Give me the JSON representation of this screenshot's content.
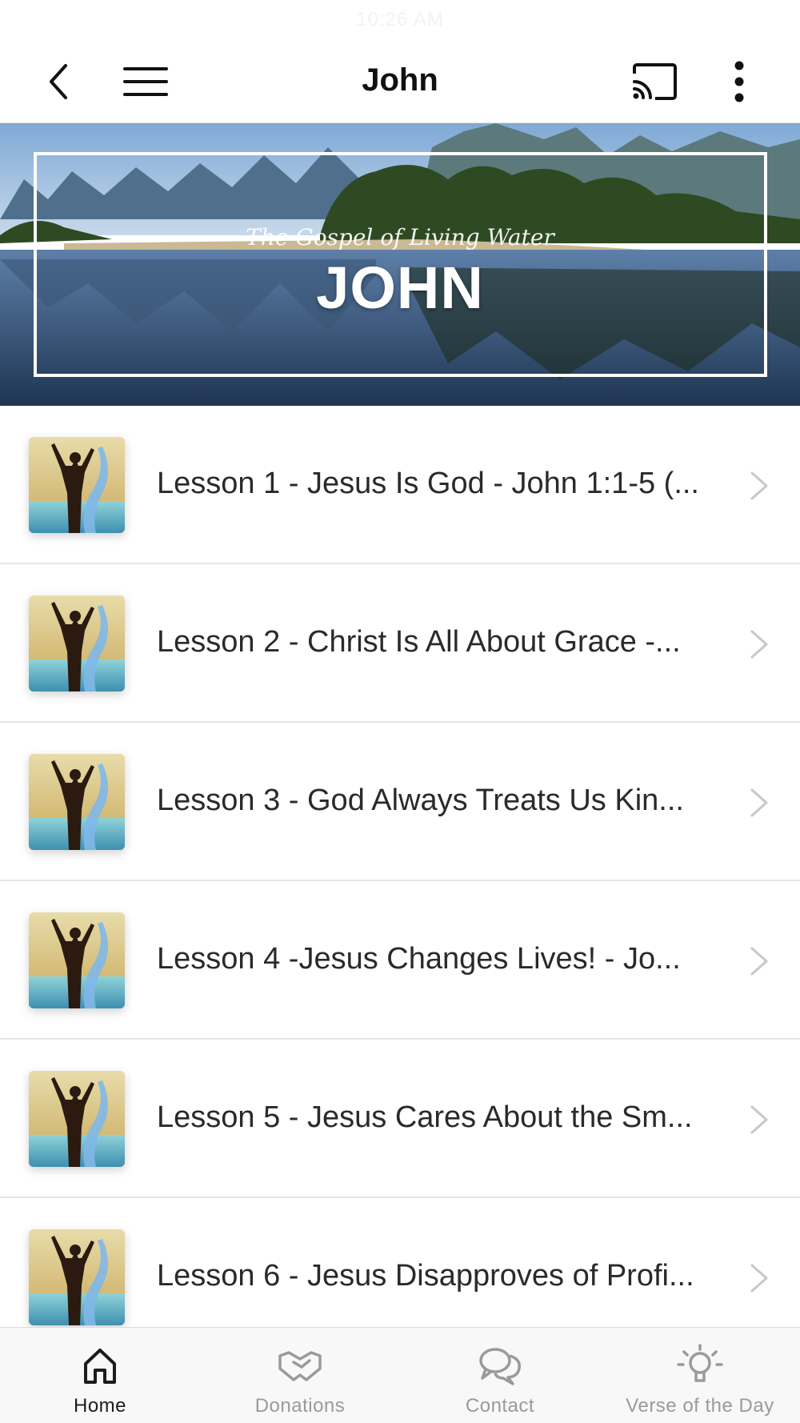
{
  "status_bar": {
    "time": "10:26 AM"
  },
  "app_bar": {
    "title": "John",
    "back_icon": "chevron-left-icon",
    "menu_icon": "hamburger-menu-icon",
    "cast_icon": "cast-icon",
    "more_icon": "more-vertical-icon"
  },
  "hero": {
    "subtitle": "The Gospel of Living Water",
    "title": "JOHN"
  },
  "lessons": [
    {
      "label": "Lesson 1 - Jesus Is God - John 1:1-5 (..."
    },
    {
      "label": "Lesson 2 - Christ Is All About Grace -..."
    },
    {
      "label": "Lesson 3 - God Always Treats Us Kin..."
    },
    {
      "label": "Lesson 4 -Jesus Changes Lives! - Jo..."
    },
    {
      "label": "Lesson 5 - Jesus Cares About the Sm..."
    },
    {
      "label": "Lesson 6 - Jesus Disapproves of Profi..."
    }
  ],
  "tabs": [
    {
      "label": "Home",
      "icon": "home-icon",
      "active": true
    },
    {
      "label": "Donations",
      "icon": "handshake-icon",
      "active": false
    },
    {
      "label": "Contact",
      "icon": "chat-bubbles-icon",
      "active": false
    },
    {
      "label": "Verse of the Day",
      "icon": "lightbulb-icon",
      "active": false
    }
  ],
  "colors": {
    "active_tab": "#1c1c1e",
    "inactive_tab": "#9a9a9a",
    "divider": "#e6e6e6"
  }
}
